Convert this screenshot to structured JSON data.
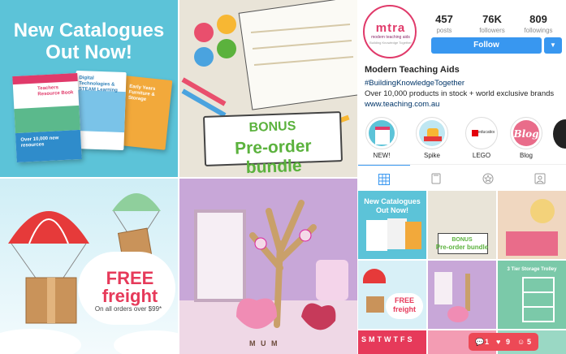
{
  "collage": {
    "catalogue": {
      "title_line1": "New Catalogues",
      "title_line2": "Out Now!",
      "book1": "Teachers Resource Book",
      "book1_sub": "Over 10,000 new resources",
      "book2": "Digital Technologies & STEAM Learning",
      "book3": "Early Years Furniture & Storage"
    },
    "bonus": {
      "line1": "BONUS",
      "line2": "Pre-order bundle"
    },
    "freight": {
      "line1": "FREE",
      "line2": "freight",
      "sub": "On all orders over $99*"
    },
    "mum_tiles": "M U M"
  },
  "profile": {
    "avatar_logo": "mtra",
    "avatar_name": "modern teaching aids",
    "avatar_tag": "Building Knowledge Together",
    "stats": [
      {
        "num": "457",
        "label": "posts"
      },
      {
        "num": "76K",
        "label": "followers"
      },
      {
        "num": "809",
        "label": "followings"
      }
    ],
    "follow_label": "Follow",
    "dropdown_glyph": "▼",
    "name": "Modern Teaching Aids",
    "hashtag": "#BuildingKnowledgeTogether",
    "description": "Over 10,000 products in stock + world exclusive brands",
    "link": "www.teaching.com.au",
    "highlights": [
      {
        "label": "NEW!"
      },
      {
        "label": "Spike"
      },
      {
        "label": "LEGO",
        "inner": "education"
      },
      {
        "label": "Blog",
        "inner": "Blog"
      }
    ],
    "tab_icons": [
      "grid-icon",
      "tv-icon",
      "star-icon",
      "tagged-icon"
    ],
    "grid": {
      "g1_line1": "New Catalogues",
      "g1_line2": "Out Now!",
      "g2_line1": "BONUS",
      "g2_line2": "Pre-order bundle",
      "g4_line1": "FREE",
      "g4_line2": "freight",
      "g6_title": "3 Tier Storage Trolley",
      "g7_days": "SMTWTFS"
    },
    "notifications": {
      "comments": "1",
      "likes": "9",
      "follows": "5"
    }
  },
  "colors": {
    "instagram_blue": "#3897f0",
    "brand_pink": "#e03a6a",
    "notif_red": "#ed4956"
  }
}
